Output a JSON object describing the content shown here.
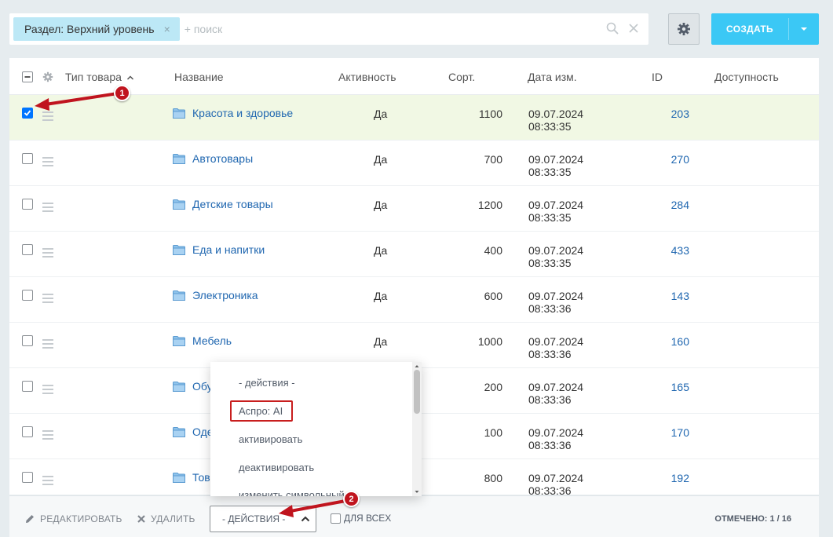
{
  "filter": {
    "chip_label": "Раздел: Верхний уровень",
    "chip_close": "×",
    "search_placeholder": "+ поиск"
  },
  "toolbar": {
    "create_label": "СОЗДАТЬ"
  },
  "table": {
    "columns": [
      "Тип товара",
      "Название",
      "Активность",
      "Сорт.",
      "Дата изм.",
      "ID",
      "Доступность"
    ],
    "rows": [
      {
        "name": "Красота и здоровье",
        "active": "Да",
        "sort": "1100",
        "date": "09.07.2024",
        "time": "08:33:35",
        "id": "203",
        "checked": true
      },
      {
        "name": "Автотовары",
        "active": "Да",
        "sort": "700",
        "date": "09.07.2024",
        "time": "08:33:35",
        "id": "270",
        "checked": false
      },
      {
        "name": "Детские товары",
        "active": "Да",
        "sort": "1200",
        "date": "09.07.2024",
        "time": "08:33:35",
        "id": "284",
        "checked": false
      },
      {
        "name": "Еда и напитки",
        "active": "Да",
        "sort": "400",
        "date": "09.07.2024",
        "time": "08:33:35",
        "id": "433",
        "checked": false
      },
      {
        "name": "Электроника",
        "active": "Да",
        "sort": "600",
        "date": "09.07.2024",
        "time": "08:33:36",
        "id": "143",
        "checked": false
      },
      {
        "name": "Мебель",
        "active": "Да",
        "sort": "1000",
        "date": "09.07.2024",
        "time": "08:33:36",
        "id": "160",
        "checked": false
      },
      {
        "name": "Обу",
        "active": "",
        "sort": "200",
        "date": "09.07.2024",
        "time": "08:33:36",
        "id": "165",
        "checked": false
      },
      {
        "name": "Оде",
        "active": "",
        "sort": "100",
        "date": "09.07.2024",
        "time": "08:33:36",
        "id": "170",
        "checked": false
      },
      {
        "name": "Тов",
        "active": "",
        "sort": "800",
        "date": "09.07.2024",
        "time": "08:33:36",
        "id": "192",
        "checked": false
      }
    ]
  },
  "dropdown": {
    "items": [
      "- действия -",
      "Аспро: AI",
      "активировать",
      "деактивировать",
      "изменить символьный"
    ]
  },
  "bottom": {
    "edit_label": "РЕДАКТИРОВАТЬ",
    "delete_label": "УДАЛИТЬ",
    "actions_label": "- ДЕЙСТВИЯ -",
    "forall_label": "ДЛЯ ВСЕХ",
    "marked_label": "ОТМЕЧЕНО: 1 / 16"
  },
  "annotations": {
    "badge1": "1",
    "badge2": "2"
  },
  "colors": {
    "accent": "#3bc8f5",
    "link": "#2067b0",
    "selected_row": "#f1f8e4",
    "annotation": "#c0141e"
  }
}
